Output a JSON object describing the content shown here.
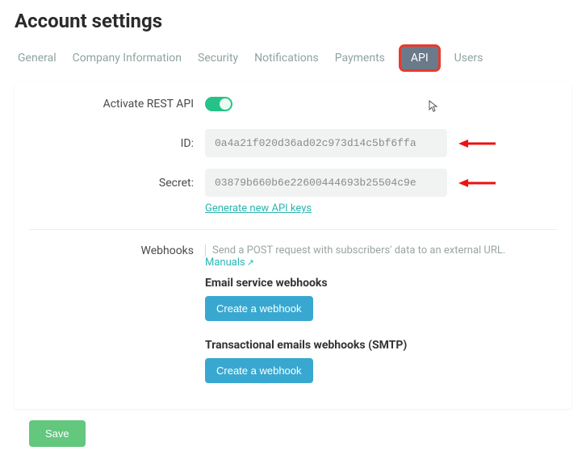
{
  "page_title": "Account settings",
  "tabs": {
    "general": "General",
    "company": "Company Information",
    "security": "Security",
    "notifications": "Notifications",
    "payments": "Payments",
    "api": "API",
    "users": "Users"
  },
  "active_tab": "api",
  "api": {
    "activate_label": "Activate REST API",
    "activate_on": true,
    "id_label": "ID:",
    "id_value": "0a4a21f020d36ad02c973d14c5bf6ffa",
    "secret_label": "Secret:",
    "secret_value": "03879b660b6e22600444693b25504c9e",
    "generate_link": "Generate new API keys"
  },
  "webhooks": {
    "heading": "Webhooks",
    "description": "Send a POST request with subscribers' data to an external URL.",
    "manuals_link": "Manuals",
    "email_title": "Email service webhooks",
    "create_label": "Create a webhook",
    "trans_title": "Transactional emails webhooks (SMTP)"
  },
  "save_label": "Save"
}
